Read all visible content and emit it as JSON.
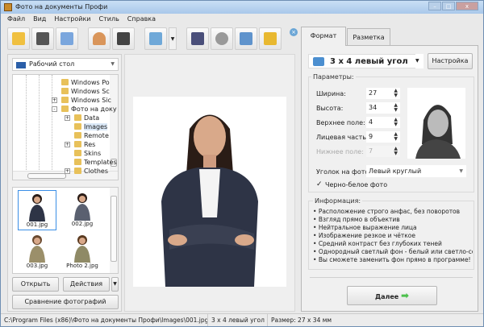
{
  "window": {
    "title": "Фото на документы Профи"
  },
  "menu": [
    "Файл",
    "Вид",
    "Настройки",
    "Стиль",
    "Справка"
  ],
  "toolbar": {
    "icons": [
      "open-icon",
      "save-icon",
      "print-icon",
      "user-search-icon",
      "camera-icon",
      "image-zoom-icon",
      "help-book-icon",
      "film-reel-icon",
      "home-icon",
      "shopping-cart-icon"
    ]
  },
  "left": {
    "drive": "Рабочий стол",
    "tree": [
      {
        "label": "Windows Po",
        "expand": ""
      },
      {
        "label": "Windows Sc",
        "expand": ""
      },
      {
        "label": "Windows Sic",
        "expand": "+"
      },
      {
        "label": "Фото на доку",
        "expand": "-"
      },
      {
        "label": "Data",
        "expand": "+"
      },
      {
        "label": "Images",
        "expand": "",
        "selected": true
      },
      {
        "label": "Remote",
        "expand": ""
      },
      {
        "label": "Res",
        "expand": "+"
      },
      {
        "label": "Skins",
        "expand": ""
      },
      {
        "label": "Templates",
        "expand": ""
      },
      {
        "label": "Clothes",
        "expand": "+"
      }
    ],
    "thumbnails": [
      {
        "name": "001.jpg",
        "selected": true
      },
      {
        "name": "002.jpg"
      },
      {
        "name": "003.jpg"
      },
      {
        "name": "Photo 2.jpg"
      }
    ],
    "open_label": "Открыть",
    "actions_label": "Действия",
    "compare_label": "Сравнение фотографий"
  },
  "tabs": [
    {
      "label": "Формат",
      "active": true
    },
    {
      "label": "Разметка"
    }
  ],
  "format": {
    "selected": "3 x 4 левый угол",
    "settings_label": "Настройка",
    "params_title": "Параметры:",
    "params": [
      {
        "label": "Ширина:",
        "value": "27",
        "enabled": true
      },
      {
        "label": "Высота:",
        "value": "34",
        "enabled": true
      },
      {
        "label": "Верхнее поле:",
        "value": "4",
        "enabled": true
      },
      {
        "label": "Лицевая часть:",
        "value": "9",
        "enabled": true
      },
      {
        "label": "Нижнее поле:",
        "value": "7",
        "enabled": false
      }
    ],
    "corner_label": "Уголок на фото:",
    "corner_value": "Левый круглый",
    "bw_label": "Черно-белое фото",
    "bw_checked": true,
    "info_title": "Информация:",
    "info": [
      "Расположение строго анфас, без поворотов",
      "Взгляд прямо в объектив",
      "Нейтральное выражение лица",
      "Изображение резкое и чёткое",
      "Средний контраст без глубоких теней",
      "Однородный светлый фон - белый или светло-серый",
      "Вы сможете заменить фон прямо в программе!"
    ],
    "next_label": "Далее"
  },
  "status": {
    "path": "C:\\Program Files (x86)\\Фото на документы Профи\\Images\\001.jpg",
    "format": "3 x 4 левый угол",
    "size": "Размер: 27 x 34 мм"
  },
  "colors": {
    "accent": "#3a8ee6",
    "titlebar": "#b7d2ef",
    "next_arrow": "#4cc04c"
  }
}
